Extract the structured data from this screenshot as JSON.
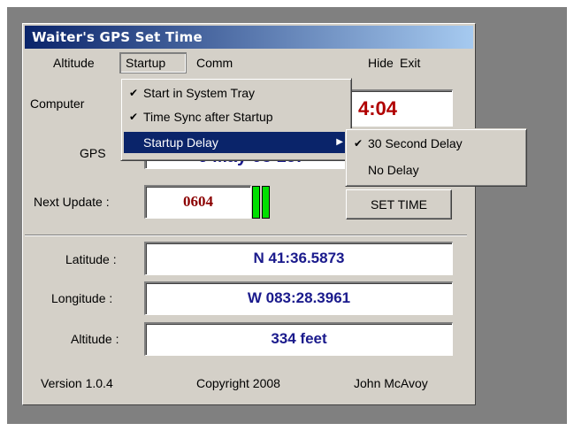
{
  "window": {
    "title": "Waiter's GPS Set Time"
  },
  "menu": {
    "altitude": "Altitude",
    "startup": "Startup",
    "comm": "Comm",
    "hide": "Hide",
    "exit": "Exit"
  },
  "startup_menu": {
    "items": [
      {
        "label": "Start in System Tray",
        "checked": true
      },
      {
        "label": "Time Sync after Startup",
        "checked": true
      },
      {
        "label": "Startup Delay",
        "has_submenu": true
      }
    ]
  },
  "delay_submenu": {
    "items": [
      {
        "label": "30 Second Delay",
        "checked": true
      },
      {
        "label": "No Delay",
        "checked": false
      }
    ]
  },
  "labels": {
    "computer": "Computer",
    "gps": "GPS",
    "next_update": "Next Update :",
    "latitude": "Latitude :",
    "longitude": "Longitude :",
    "altitude": "Altitude :"
  },
  "values": {
    "computer_time_partial": "4:04",
    "gps_partial": "6 May 08   15:",
    "next_update": "0604",
    "latitude": "N 41:36.5873",
    "longitude": "W 083:28.3961",
    "altitude": "334 feet"
  },
  "buttons": {
    "set_time": "SET TIME"
  },
  "footer": {
    "version": "Version 1.0.4",
    "copyright": "Copyright 2008",
    "author": "John McAvoy"
  },
  "colors": {
    "title_bar": "#0a246a",
    "highlight": "#0a246a",
    "value_text": "#1a1a8c",
    "update_text": "#8b0000",
    "indicator": "#00e000"
  }
}
